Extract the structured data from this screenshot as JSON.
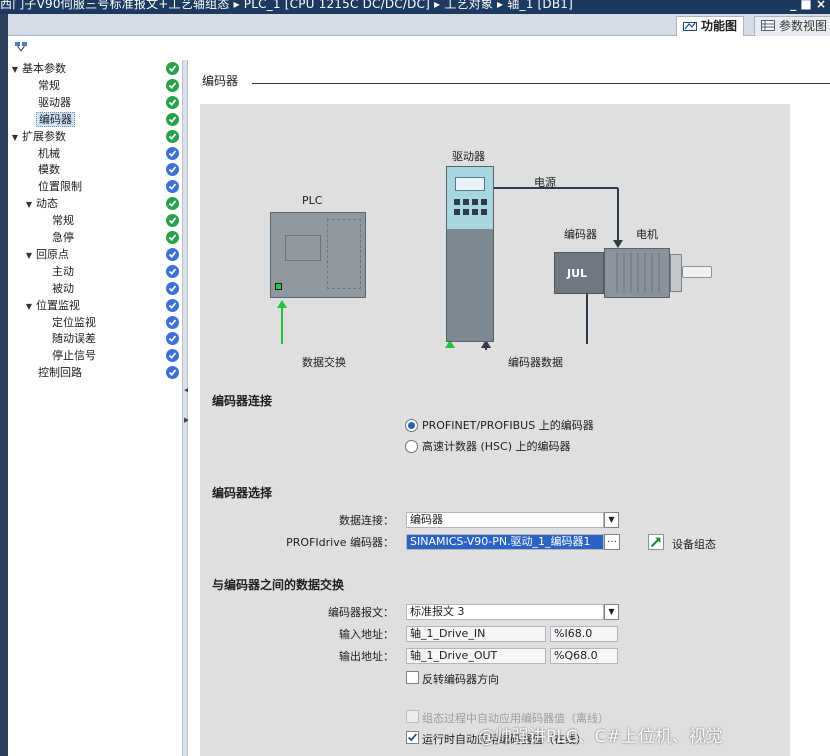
{
  "window": {
    "title": "西门子V90伺服三号标准报文+工艺轴组态 ▸ PLC_1 [CPU 1215C DC/DC/DC] ▸ 工艺对象 ▸ 轴_1 [DB1]",
    "control_label": "_ ■ ×"
  },
  "tabs": {
    "function_view": "功能图",
    "param_view": "参数视图"
  },
  "nav": {
    "items": [
      {
        "label": "基本参数",
        "level": 0,
        "expander": "▼",
        "status": "ok",
        "selected": false
      },
      {
        "label": "常规",
        "level": 1,
        "expander": "",
        "status": "ok",
        "selected": false
      },
      {
        "label": "驱动器",
        "level": 1,
        "expander": "",
        "status": "ok",
        "selected": false
      },
      {
        "label": "编码器",
        "level": 1,
        "expander": "",
        "status": "ok",
        "selected": true
      },
      {
        "label": "扩展参数",
        "level": 0,
        "expander": "▼",
        "status": "ok",
        "selected": false
      },
      {
        "label": "机械",
        "level": 1,
        "expander": "",
        "status": "info",
        "selected": false
      },
      {
        "label": "模数",
        "level": 1,
        "expander": "",
        "status": "info",
        "selected": false
      },
      {
        "label": "位置限制",
        "level": 1,
        "expander": "",
        "status": "info",
        "selected": false
      },
      {
        "label": "动态",
        "level": 1,
        "expander": "▼",
        "status": "ok",
        "selected": false
      },
      {
        "label": "常规",
        "level": 2,
        "expander": "",
        "status": "ok",
        "selected": false
      },
      {
        "label": "急停",
        "level": 2,
        "expander": "",
        "status": "ok",
        "selected": false
      },
      {
        "label": "回原点",
        "level": 1,
        "expander": "▼",
        "status": "info",
        "selected": false
      },
      {
        "label": "主动",
        "level": 2,
        "expander": "",
        "status": "info",
        "selected": false
      },
      {
        "label": "被动",
        "level": 2,
        "expander": "",
        "status": "info",
        "selected": false
      },
      {
        "label": "位置监视",
        "level": 1,
        "expander": "▼",
        "status": "info",
        "selected": false
      },
      {
        "label": "定位监视",
        "level": 2,
        "expander": "",
        "status": "info",
        "selected": false
      },
      {
        "label": "随动误差",
        "level": 2,
        "expander": "",
        "status": "info",
        "selected": false
      },
      {
        "label": "停止信号",
        "level": 2,
        "expander": "",
        "status": "info",
        "selected": false
      },
      {
        "label": "控制回路",
        "level": 1,
        "expander": "",
        "status": "info",
        "selected": false
      }
    ]
  },
  "content": {
    "section_title": "编码器",
    "diagram": {
      "drive_label": "驱动器",
      "power_label": "电源",
      "plc_label": "PLC",
      "encoder_label": "编码器",
      "motor_label": "电机",
      "data_exchange_label": "数据交换",
      "encoder_data_label": "编码器数据",
      "pulse_symbol": "JUL"
    },
    "encoder_connection": {
      "title": "编码器连接",
      "options": [
        {
          "label": "PROFINET/PROFIBUS 上的编码器",
          "selected": true
        },
        {
          "label": "高速计数器 (HSC) 上的编码器",
          "selected": false
        }
      ]
    },
    "encoder_selection": {
      "title": "编码器选择",
      "data_connection_label": "数据连接：",
      "data_connection_value": "编码器",
      "profidrive_label": "PROFIdrive 编码器：",
      "profidrive_value": "SINAMICS-V90-PN.驱动_1_编码器1",
      "browse_label": "...",
      "device_config_label": "设备组态"
    },
    "data_exchange": {
      "title": "与编码器之间的数据交换",
      "telegram_label": "编码器报文：",
      "telegram_value": "标准报文 3",
      "input_label": "输入地址：",
      "input_tag": "轴_1_Drive_IN",
      "input_address": "%I68.0",
      "output_label": "输出地址：",
      "output_tag": "轴_1_Drive_OUT",
      "output_address": "%Q68.0",
      "reverse_label": "反转编码器方向",
      "reverse_checked": false,
      "auto_apply_offline_label": "组态过程中自动应用编码器值（离线）",
      "auto_apply_online_label": "运行时自动应用编码器值（在线）",
      "auto_apply_offline_checked": false,
      "auto_apply_online_checked": true
    }
  },
  "watermark": "@帅强讲PLC、C#上位机、视觉",
  "colors": {
    "status_ok": "#27a24a",
    "status_info": "#3f6fd8",
    "connector_green": "#22c43d",
    "connector_dark": "#2f3b46",
    "selection_blue": "#2b63c5",
    "titlebar": "#1c3a60"
  }
}
